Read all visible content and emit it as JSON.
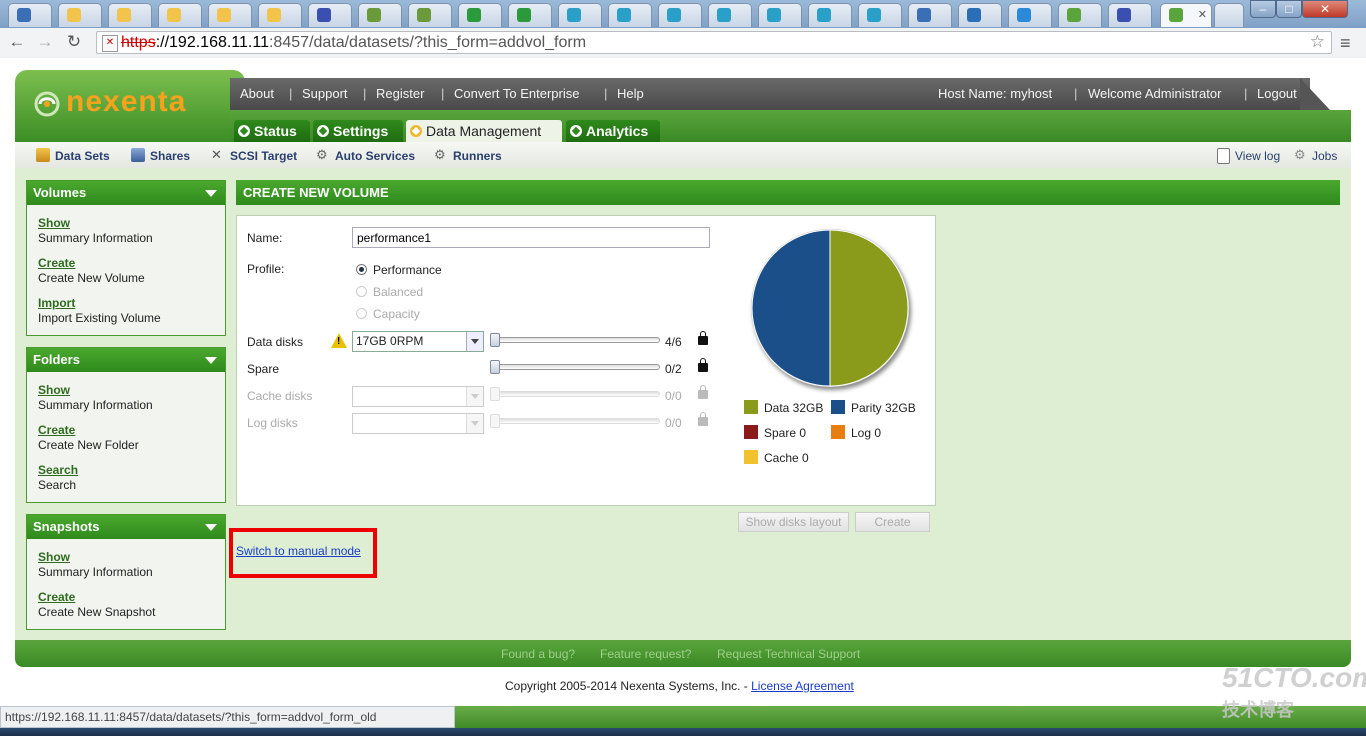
{
  "browser": {
    "url_scheme": "https",
    "url_host": "://192.168.11.11",
    "url_rest": ":8457/data/datasets/?this_form=addvol_form",
    "status_url": "https://192.168.11.11:8457/data/datasets/?this_form=addvol_form_old"
  },
  "header": {
    "logo": "nexenta",
    "top_links": [
      "About",
      "Support",
      "Register",
      "Convert To Enterprise",
      "Help"
    ],
    "host_name": "Host Name: myhost",
    "welcome": "Welcome Administrator",
    "logout": "Logout"
  },
  "main_tabs": [
    {
      "label": "Status",
      "active": false
    },
    {
      "label": "Settings",
      "active": false
    },
    {
      "label": "Data Management",
      "active": true
    },
    {
      "label": "Analytics",
      "active": false
    }
  ],
  "subnav": {
    "items": [
      "Data Sets",
      "Shares",
      "SCSI Target",
      "Auto Services",
      "Runners"
    ],
    "right": [
      "View log",
      "Jobs"
    ]
  },
  "sidebar": {
    "volumes": {
      "title": "Volumes",
      "items": [
        {
          "link": "Show",
          "desc": "Summary Information"
        },
        {
          "link": "Create",
          "desc": "Create New Volume"
        },
        {
          "link": "Import",
          "desc": "Import Existing Volume"
        }
      ]
    },
    "folders": {
      "title": "Folders",
      "items": [
        {
          "link": "Show",
          "desc": "Summary Information"
        },
        {
          "link": "Create",
          "desc": "Create New Folder"
        },
        {
          "link": "Search",
          "desc": "Search"
        }
      ]
    },
    "snapshots": {
      "title": "Snapshots",
      "items": [
        {
          "link": "Show",
          "desc": "Summary Information"
        },
        {
          "link": "Create",
          "desc": "Create New Snapshot"
        }
      ]
    }
  },
  "form": {
    "title": "CREATE NEW VOLUME",
    "name_label": "Name:",
    "name_value": "performance1",
    "profile_label": "Profile:",
    "profiles": [
      {
        "label": "Performance",
        "selected": true,
        "enabled": true
      },
      {
        "label": "Balanced",
        "selected": false,
        "enabled": false
      },
      {
        "label": "Capacity",
        "selected": false,
        "enabled": false
      }
    ],
    "rows": [
      {
        "label": "Data disks",
        "select": "17GB 0RPM",
        "value": "4/6",
        "enabled": true,
        "fraction": 0.0
      },
      {
        "label": "Spare",
        "select": "",
        "value": "0/2",
        "enabled": true,
        "fraction": 0.0
      },
      {
        "label": "Cache disks",
        "select": "",
        "value": "0/0",
        "enabled": false,
        "fraction": 0.0
      },
      {
        "label": "Log disks",
        "select": "",
        "value": "0/0",
        "enabled": false,
        "fraction": 0.0
      }
    ],
    "buttons": {
      "show_layout": "Show disks layout",
      "create": "Create"
    },
    "manual_mode": "Switch to manual mode"
  },
  "pie": {
    "legend": [
      {
        "label": "Data 32GB",
        "color": "#8a9a1a"
      },
      {
        "label": "Parity 32GB",
        "color": "#1b4f8a"
      },
      {
        "label": "Spare 0",
        "color": "#8b1a1a"
      },
      {
        "label": "Log 0",
        "color": "#e67e12"
      },
      {
        "label": "Cache 0",
        "color": "#f2c22e"
      }
    ],
    "values": [
      32,
      32,
      0,
      0,
      0
    ]
  },
  "footer": {
    "links": [
      "Found a bug?",
      "Feature request?",
      "Request Technical Support"
    ],
    "copyright": "Copyright 2005-2014 Nexenta Systems, Inc. - ",
    "license": "License Agreement"
  },
  "watermark": {
    "main": "51CTO.com",
    "sub": "技术博客"
  }
}
